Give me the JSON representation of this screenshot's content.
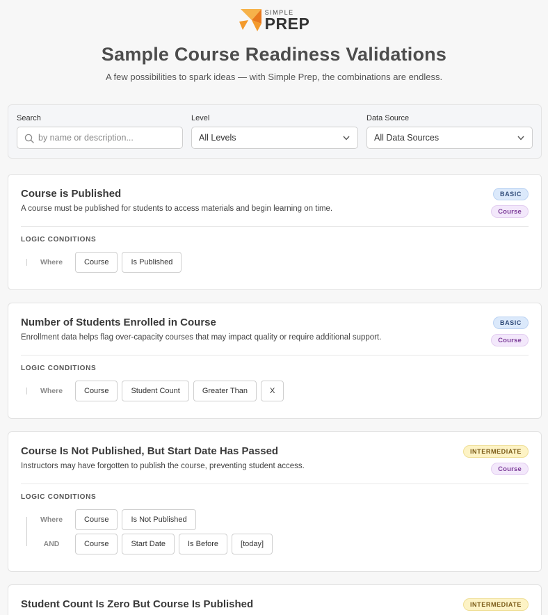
{
  "brand": {
    "simple": "SIMPLE",
    "prep": "PREP",
    "accent": "#f6a93b",
    "accent_dark": "#e8791d"
  },
  "header": {
    "title": "Sample Course Readiness Validations",
    "subtitle": "A few possibilities to spark ideas — with Simple Prep, the combinations are endless."
  },
  "filters": {
    "search": {
      "label": "Search",
      "placeholder": "by name or description...",
      "value": ""
    },
    "level": {
      "label": "Level",
      "selected": "All Levels"
    },
    "source": {
      "label": "Data Source",
      "selected": "All Data Sources"
    }
  },
  "cards": [
    {
      "title": "Course is Published",
      "description": "A course must be published for students to access materials and begin learning on time.",
      "level": "BASIC",
      "source": "Course",
      "conditions_label": "LOGIC CONDITIONS",
      "rows": [
        {
          "joiner": "Where",
          "chips": [
            "Course",
            "Is Published"
          ]
        }
      ]
    },
    {
      "title": "Number of Students Enrolled in Course",
      "description": "Enrollment data helps flag over-capacity courses that may impact quality or require additional support.",
      "level": "BASIC",
      "source": "Course",
      "conditions_label": "LOGIC CONDITIONS",
      "rows": [
        {
          "joiner": "Where",
          "chips": [
            "Course",
            "Student Count",
            "Greater Than",
            "X"
          ]
        }
      ]
    },
    {
      "title": "Course Is Not Published, But Start Date Has Passed",
      "description": "Instructors may have forgotten to publish the course, preventing student access.",
      "level": "INTERMEDIATE",
      "source": "Course",
      "conditions_label": "LOGIC CONDITIONS",
      "rows": [
        {
          "joiner": "Where",
          "chips": [
            "Course",
            "Is Not Published"
          ]
        },
        {
          "joiner": "AND",
          "chips": [
            "Course",
            "Start Date",
            "Is Before",
            "[today]"
          ]
        }
      ]
    },
    {
      "title": "Student Count Is Zero But Course Is Published",
      "level": "INTERMEDIATE"
    }
  ]
}
